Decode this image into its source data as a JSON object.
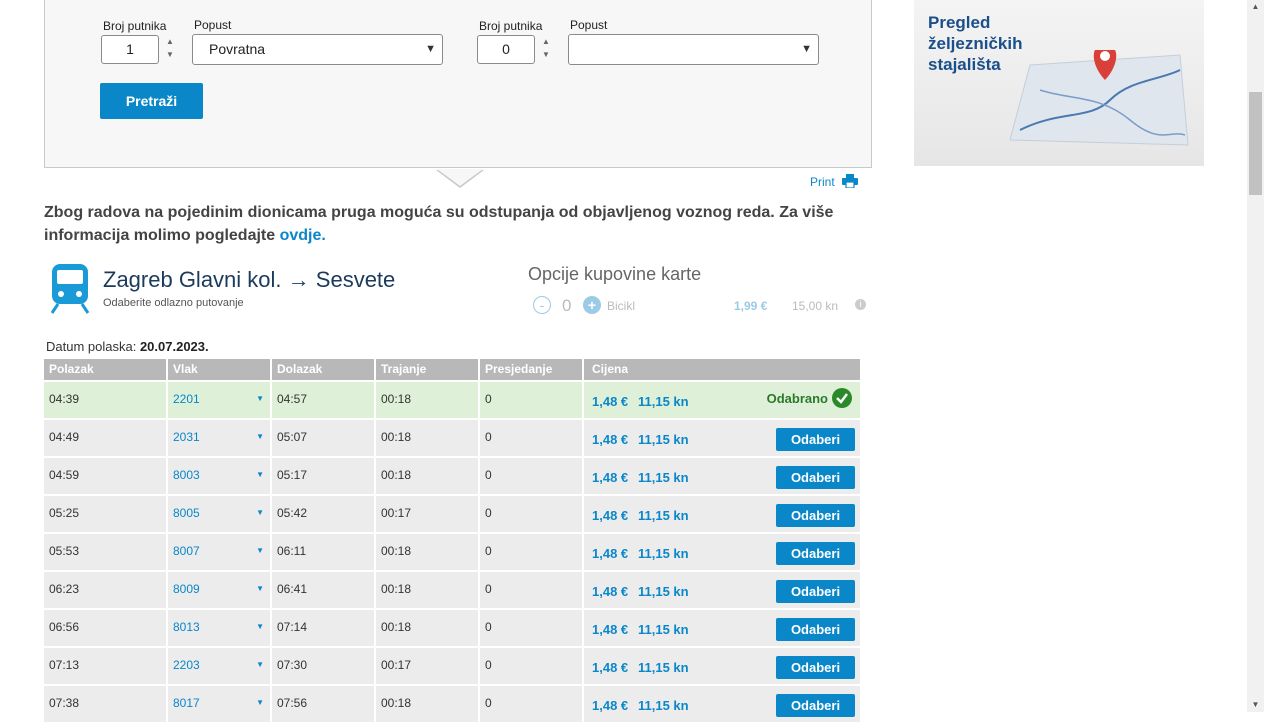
{
  "search": {
    "passengers_label_1": "Broj putnika",
    "discount_label_1": "Popust",
    "passengers_value_1": "1",
    "discount_value_1": "Povratna",
    "passengers_label_2": "Broj putnika",
    "discount_label_2": "Popust",
    "passengers_value_2": "0",
    "discount_value_2": "",
    "search_button": "Pretraži"
  },
  "print_label": "Print",
  "notice": {
    "text": "Zbog radova na pojedinim dionicama pruga moguća su odstupanja od objavljenog voznog reda. Za više informacija molimo pogledajte ",
    "link": "ovdje."
  },
  "route": {
    "from": "Zagreb Glavni kol.",
    "arrow": "→",
    "to": "Sesvete",
    "subtitle": "Odaberite odlazno putovanje"
  },
  "options": {
    "title": "Opcije kupovine karte",
    "count": "0",
    "item": "Bicikl",
    "price_eur": "1,99 €",
    "price_kn": "15,00 kn"
  },
  "date": {
    "label": "Datum polaska:",
    "value": "20.07.2023."
  },
  "table": {
    "headers": [
      "Polazak",
      "Vlak",
      "Dolazak",
      "Trajanje",
      "Presjedanje",
      "Cijena"
    ],
    "select_label": "Odaberi",
    "selected_label": "Odabrano",
    "rows": [
      {
        "dep": "04:39",
        "train": "2201",
        "arr": "04:57",
        "dur": "00:18",
        "change": "0",
        "eur": "1,48 €",
        "kn": "11,15 kn"
      },
      {
        "dep": "04:49",
        "train": "2031",
        "arr": "05:07",
        "dur": "00:18",
        "change": "0",
        "eur": "1,48 €",
        "kn": "11,15 kn"
      },
      {
        "dep": "04:59",
        "train": "8003",
        "arr": "05:17",
        "dur": "00:18",
        "change": "0",
        "eur": "1,48 €",
        "kn": "11,15 kn"
      },
      {
        "dep": "05:25",
        "train": "8005",
        "arr": "05:42",
        "dur": "00:17",
        "change": "0",
        "eur": "1,48 €",
        "kn": "11,15 kn"
      },
      {
        "dep": "05:53",
        "train": "8007",
        "arr": "06:11",
        "dur": "00:18",
        "change": "0",
        "eur": "1,48 €",
        "kn": "11,15 kn"
      },
      {
        "dep": "06:23",
        "train": "8009",
        "arr": "06:41",
        "dur": "00:18",
        "change": "0",
        "eur": "1,48 €",
        "kn": "11,15 kn"
      },
      {
        "dep": "06:56",
        "train": "8013",
        "arr": "07:14",
        "dur": "00:18",
        "change": "0",
        "eur": "1,48 €",
        "kn": "11,15 kn"
      },
      {
        "dep": "07:13",
        "train": "2203",
        "arr": "07:30",
        "dur": "00:17",
        "change": "0",
        "eur": "1,48 €",
        "kn": "11,15 kn"
      },
      {
        "dep": "07:38",
        "train": "8017",
        "arr": "07:56",
        "dur": "00:18",
        "change": "0",
        "eur": "1,48 €",
        "kn": "11,15 kn"
      }
    ]
  },
  "ad": {
    "text": "Pregled željezničkih stajališta"
  },
  "colors": {
    "accent": "#0a87c9",
    "selected_row": "#dff0d8",
    "header": "#b8b8b8"
  }
}
